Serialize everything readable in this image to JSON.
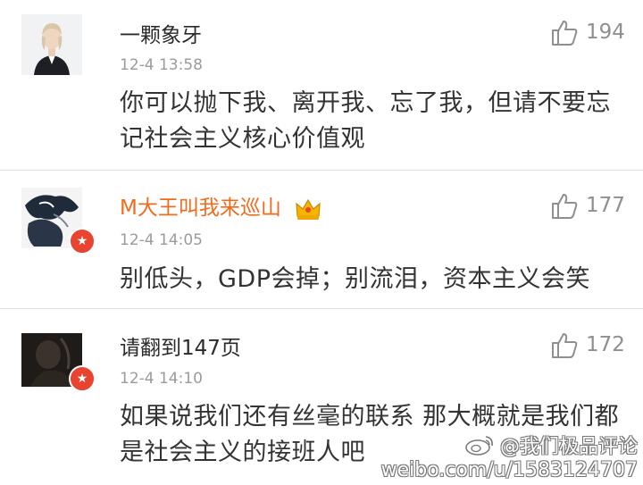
{
  "comments": [
    {
      "username": "一颗象牙",
      "time": "12-4 13:58",
      "text": "你可以抛下我、离开我、忘了我，但请不要忘记社会主义核心价值观",
      "likes": "194",
      "username_color": "#2a2a2a",
      "avatar_icon": "woman-portrait-avatar"
    },
    {
      "username": "M大王叫我来巡山",
      "time": "12-4 14:05",
      "text": "别低头，GDP会掉；别流泪，资本主义会笑",
      "likes": "177",
      "username_color": "#ef6b1e",
      "avatar_icon": "illustrated-avatar",
      "badges": [
        "verified-star-icon",
        "vip-crown-icon"
      ]
    },
    {
      "username": "请翻到147页",
      "time": "12-4 14:10",
      "text": "如果说我们还有丝毫的联系 那大概就是我们都是社会主义的接班人吧",
      "likes": "172",
      "username_color": "#2a2a2a",
      "avatar_icon": "dark-photo-avatar",
      "badges": [
        "verified-star-icon"
      ]
    }
  ],
  "watermark": {
    "line1": "@我们极品评论",
    "line2": "weibo.com/u/1583124707"
  },
  "colors": {
    "badge": "#e8442f",
    "vip_name": "#ef6b1e",
    "divider": "#e2e2e2"
  }
}
